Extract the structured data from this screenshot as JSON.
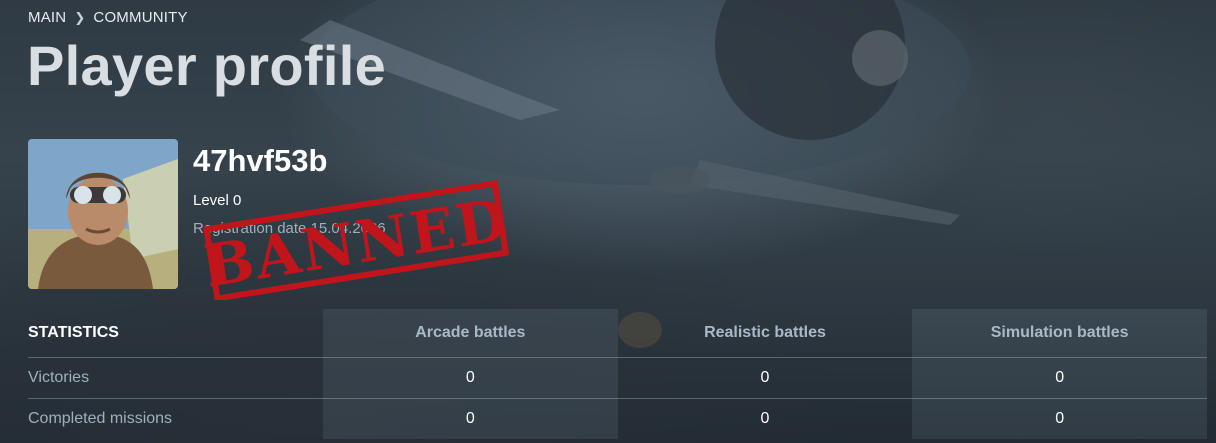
{
  "breadcrumb": {
    "items": [
      "MAIN",
      "COMMUNITY"
    ]
  },
  "page": {
    "title": "Player profile"
  },
  "profile": {
    "username": "47hvf53b",
    "level": "Level 0",
    "registration": "Registration date 15.04.2026",
    "stamp": "BANNED"
  },
  "stats": {
    "header": "STATISTICS",
    "modes": [
      "Arcade battles",
      "Realistic battles",
      "Simulation battles"
    ],
    "rows": [
      {
        "label": "Victories",
        "values": [
          "0",
          "0",
          "0"
        ]
      },
      {
        "label": "Completed missions",
        "values": [
          "0",
          "0",
          "0"
        ]
      }
    ]
  },
  "colors": {
    "stamp_red": "#c0151b",
    "label_blue": "#9fb0bd",
    "title_gray": "#d9dee2"
  }
}
